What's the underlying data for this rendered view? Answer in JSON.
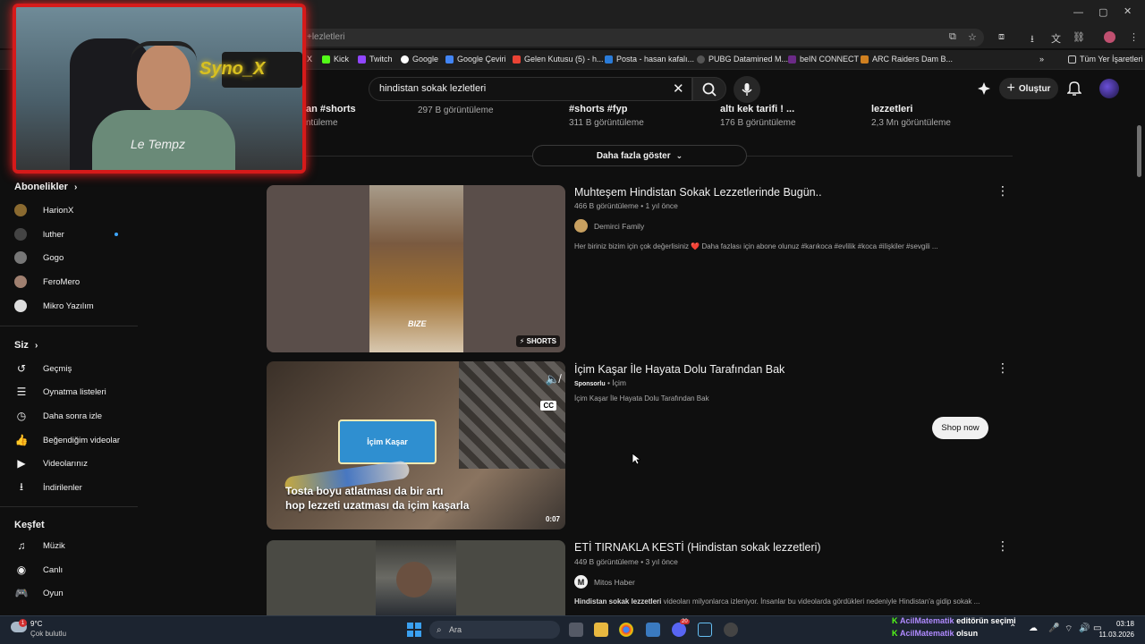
{
  "browser": {
    "url": "+lezletleri",
    "bookmarks": [
      "X",
      "Kick",
      "Twitch",
      "Google",
      "Google Çeviri",
      "Gelen Kutusu (5) - h...",
      "Posta - hasan kafalı...",
      "PUBG Datamined M...",
      "beIN CONNECT",
      "ARC Raiders Dam B..."
    ],
    "bookmarks_all": "Tüm Yer İşaretleri",
    "overflow": "»"
  },
  "youtube": {
    "search_value": "hindistan sokak lezletleri",
    "create_label": "Oluştur",
    "chips": [
      {
        "title": "an #shorts",
        "views": "ntüleme"
      },
      {
        "title": "",
        "views": "297 B görüntüleme"
      },
      {
        "title": "#shorts #fyp",
        "views": "311 B görüntüleme"
      },
      {
        "title": "altı kek tarifi ! ...",
        "views": "176 B görüntüleme"
      },
      {
        "title": "lezzetleri",
        "views": "2,3 Mn görüntüleme"
      }
    ],
    "more_label": "Daha fazla göster"
  },
  "sidebar": {
    "subscriptions_title": "Abonelikler",
    "subscriptions": [
      {
        "label": "HarionX"
      },
      {
        "label": "luther"
      },
      {
        "label": "Gogo"
      },
      {
        "label": "FeroMero"
      },
      {
        "label": "Mikro Yazılım"
      }
    ],
    "you_title": "Siz",
    "you_items": [
      {
        "label": "Geçmiş",
        "icon": "history-icon"
      },
      {
        "label": "Oynatma listeleri",
        "icon": "playlists-icon"
      },
      {
        "label": "Daha sonra izle",
        "icon": "watch-later-icon"
      },
      {
        "label": "Beğendiğim videolar",
        "icon": "like-icon"
      },
      {
        "label": "Videolarınız",
        "icon": "your-videos-icon"
      },
      {
        "label": "İndirilenler",
        "icon": "download-icon"
      }
    ],
    "explore_title": "Keşfet",
    "explore_items": [
      {
        "label": "Müzik",
        "icon": "music-icon"
      },
      {
        "label": "Canlı",
        "icon": "live-icon"
      },
      {
        "label": "Oyun",
        "icon": "gaming-icon"
      }
    ]
  },
  "results": [
    {
      "title": "Muhteşem Hindistan Sokak Lezzetlerinde Bugün..",
      "meta": "466 B görüntüleme • 1 yıl önce",
      "channel": "Demirci Family",
      "description": "Her biriniz bizim için çok değerlisiniz ❤️ Daha fazlası için abone olunuz #karıkoca #evlilik #koca #ilişkiler #sevgili ...",
      "badge": "SHORTS",
      "overlay_text": "BIZE"
    },
    {
      "title": "İçim Kaşar İle Hayata Dolu Tarafından Bak",
      "sponsored": "Sponsorlu",
      "advertiser": "İçim",
      "description": "İçim Kaşar İle Hayata Dolu Tarafından Bak",
      "cta": "Shop now",
      "caption_line1": "Tosta boyu atlatması da bir artı",
      "caption_line2": "hop lezzeti uzatması da içim kaşarla",
      "duration": "0:07",
      "cc": "CC",
      "package_text": "İçim Kaşar"
    },
    {
      "title": "ETİ TIRNAKLA KESTİ (Hindistan sokak lezzetleri)",
      "meta": "449 B görüntüleme • 3 yıl önce",
      "channel": "Mitos Haber",
      "channel_initial": "M",
      "description_bold": "Hindistan sokak lezzetleri",
      "description": " videoları milyonlarca izleniyor. İnsanlar bu videolarda gördükleri nedeniyle Hindistan'a gidip sokak ..."
    }
  ],
  "webcam": {
    "sign_text": "Syno_X",
    "shirt_text": "Le Tempz"
  },
  "taskbar": {
    "weather_temp": "9°C",
    "weather_desc": "Çok bulutlu",
    "weather_badge": "1",
    "search_label": "Ara",
    "notif1_user": "AcilMatematik",
    "notif1_text": "editörün seçimi",
    "notif2_user": "AcilMatematik",
    "notif2_text": "olsun",
    "time": "03:18",
    "date": "11.03.2026",
    "discord_badge": "20"
  }
}
